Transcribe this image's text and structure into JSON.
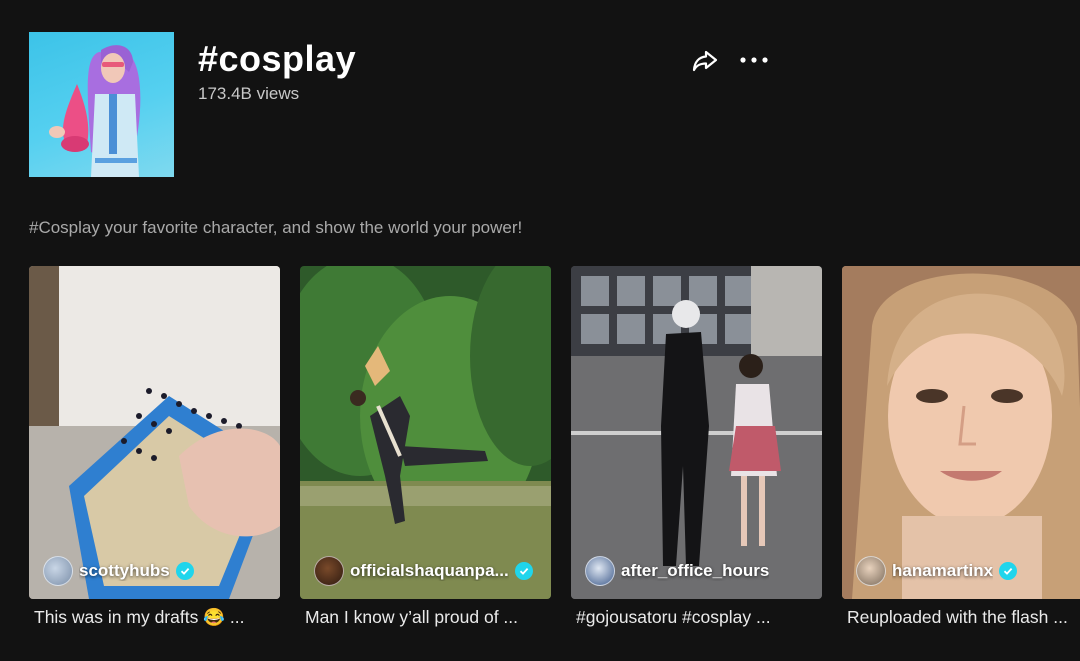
{
  "hashtag": {
    "title": "#cosplay",
    "views": "173.4B views",
    "description": "#Cosplay your favorite character, and show the world your power!"
  },
  "actions": {
    "share_icon": "share-arrow-icon",
    "more_icon": "more-dots-icon"
  },
  "videos": [
    {
      "username": "scottyhubs",
      "verified": true,
      "caption": "This was in my drafts 😂 ..."
    },
    {
      "username": "officialshaquanpa...",
      "verified": true,
      "caption": "Man I know y’all proud of ..."
    },
    {
      "username": "after_office_hours",
      "verified": false,
      "caption": "#gojousatoru #cosplay ..."
    },
    {
      "username": "hanamartinx",
      "verified": true,
      "caption": "Reuploaded with the flash ..."
    }
  ],
  "colors": {
    "background": "#121212",
    "verified_badge": "#20d5ec",
    "muted_text": "#a9a9a9"
  }
}
